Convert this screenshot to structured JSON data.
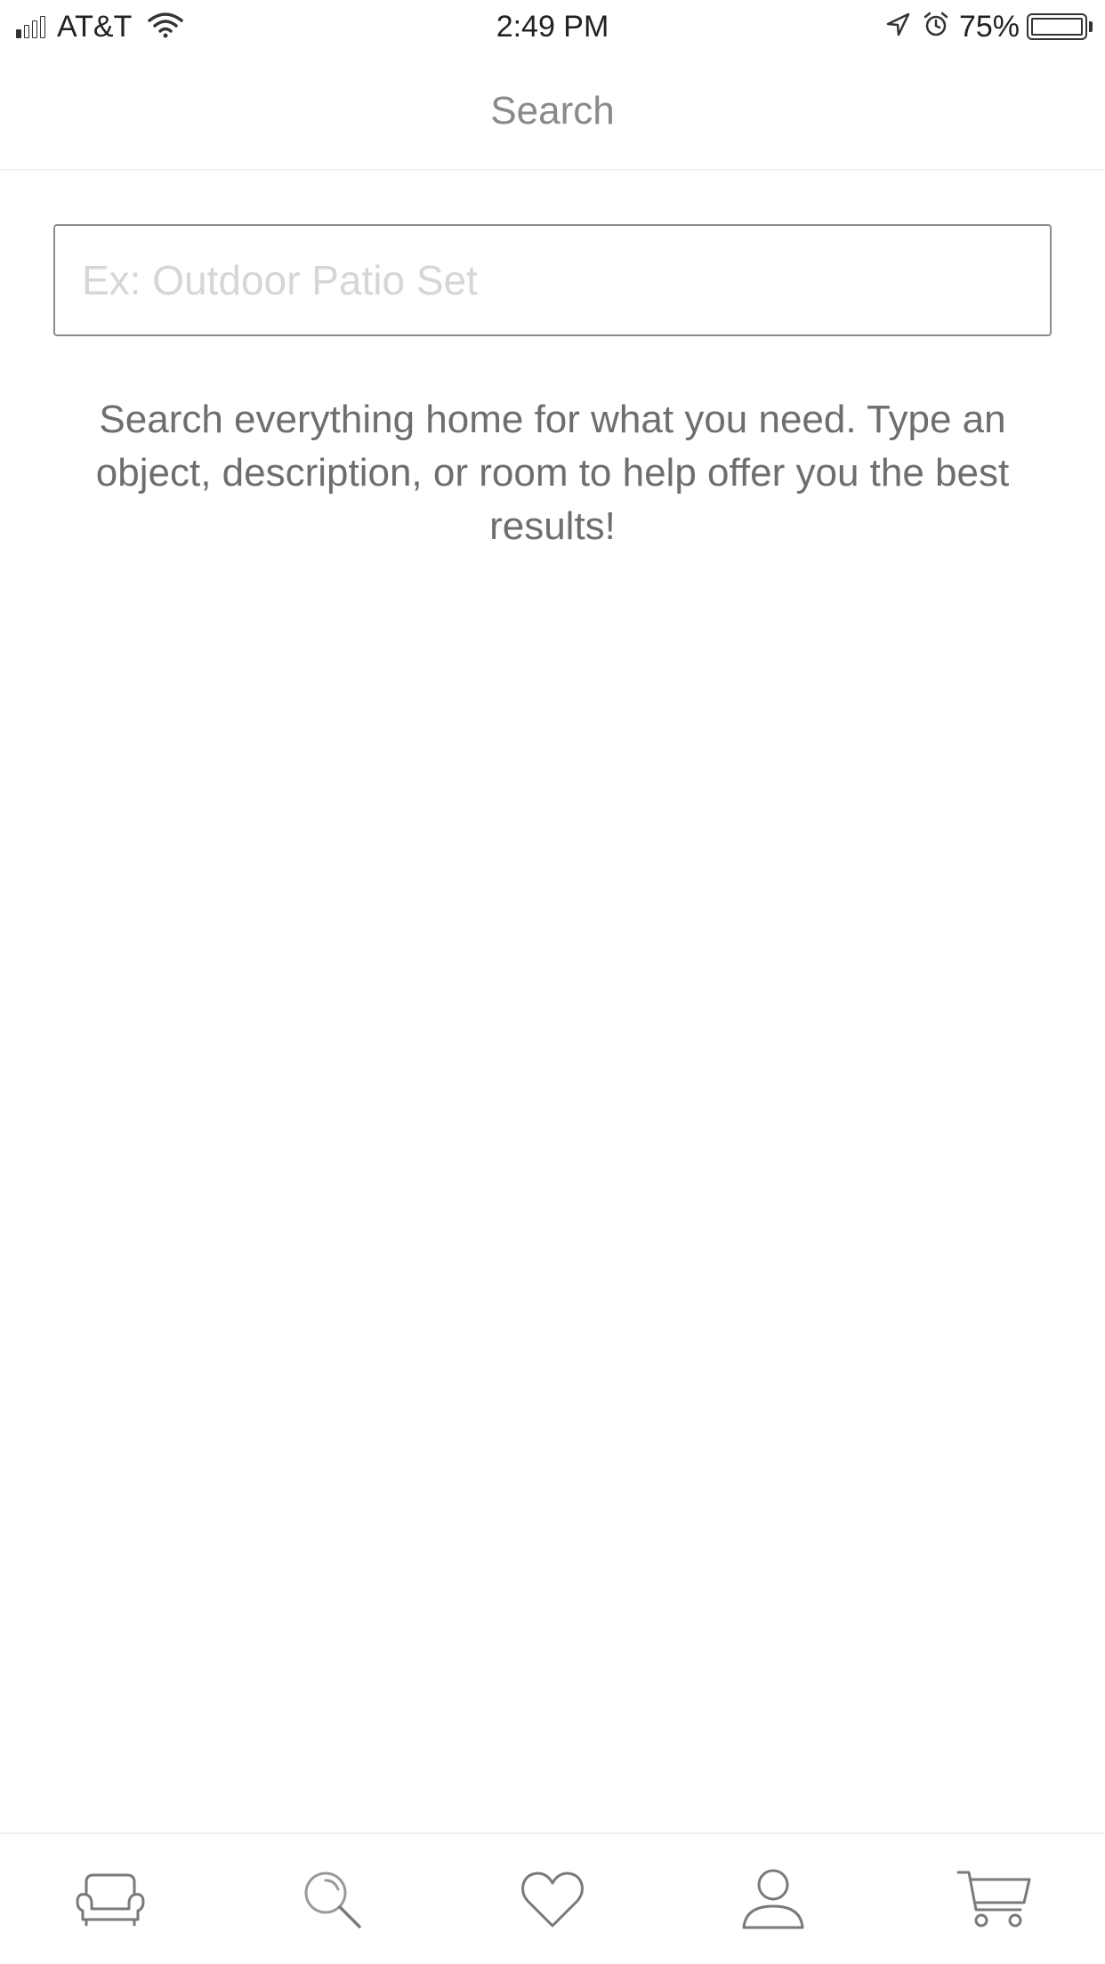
{
  "status_bar": {
    "carrier": "AT&T",
    "time": "2:49 PM",
    "battery_percent": "75%",
    "signal_bars_filled": 1,
    "signal_bars_total": 4,
    "icons": [
      "signal-icon",
      "wifi-icon",
      "location-arrow-icon",
      "alarm-icon",
      "battery-icon"
    ]
  },
  "header": {
    "title": "Search"
  },
  "search": {
    "value": "",
    "placeholder": "Ex: Outdoor Patio Set"
  },
  "hint_text": "Search everything home for what you need. Type an object, description, or room to help offer you the best results!",
  "tab_bar": {
    "items": [
      {
        "name": "home",
        "icon": "sofa-icon",
        "active": false
      },
      {
        "name": "search",
        "icon": "search-icon",
        "active": true
      },
      {
        "name": "favorites",
        "icon": "heart-icon",
        "active": false
      },
      {
        "name": "account",
        "icon": "person-icon",
        "active": false
      },
      {
        "name": "cart",
        "icon": "cart-icon",
        "active": false
      }
    ]
  },
  "colors": {
    "title": "#8a8a8a",
    "hint": "#6e6e6e",
    "placeholder": "#d6d6d6",
    "icon": "#7a7a7a",
    "divider": "#f0f0f0"
  }
}
